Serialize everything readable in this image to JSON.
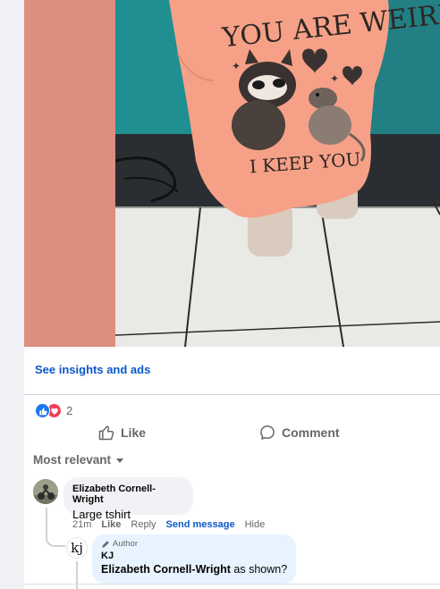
{
  "post": {
    "image": {
      "shirt_print_top": "YOU ARE WEIRD",
      "shirt_print_bottom": "I KEEP YOU",
      "colors": {
        "shirt": "#f6a187",
        "strip": "#dc8e7f",
        "wall": "#1f8f92",
        "floor": "#e9e9e6"
      }
    },
    "insights_link": "See insights and ads",
    "reactions": {
      "icons": [
        "like-icon",
        "love-icon"
      ],
      "count": "2"
    },
    "actions": {
      "like": "Like",
      "comment": "Comment"
    }
  },
  "comments": {
    "sort_label": "Most relevant",
    "items": [
      {
        "author": "Elizabeth Cornell-Wright",
        "text": "Large tshirt",
        "time": "21m",
        "like": "Like",
        "reply": "Reply",
        "send_message": "Send message",
        "hide": "Hide"
      }
    ],
    "reply": {
      "avatar_text": "kj",
      "badge": "Author",
      "author": "KJ",
      "mention": "Elizabeth Cornell-Wright",
      "text": " as shown?"
    }
  },
  "colors": {
    "link": "#0a58ca",
    "like_blue": "#1877f2",
    "love_red": "#f33e58",
    "author_bubble": "#e7f3ff"
  }
}
